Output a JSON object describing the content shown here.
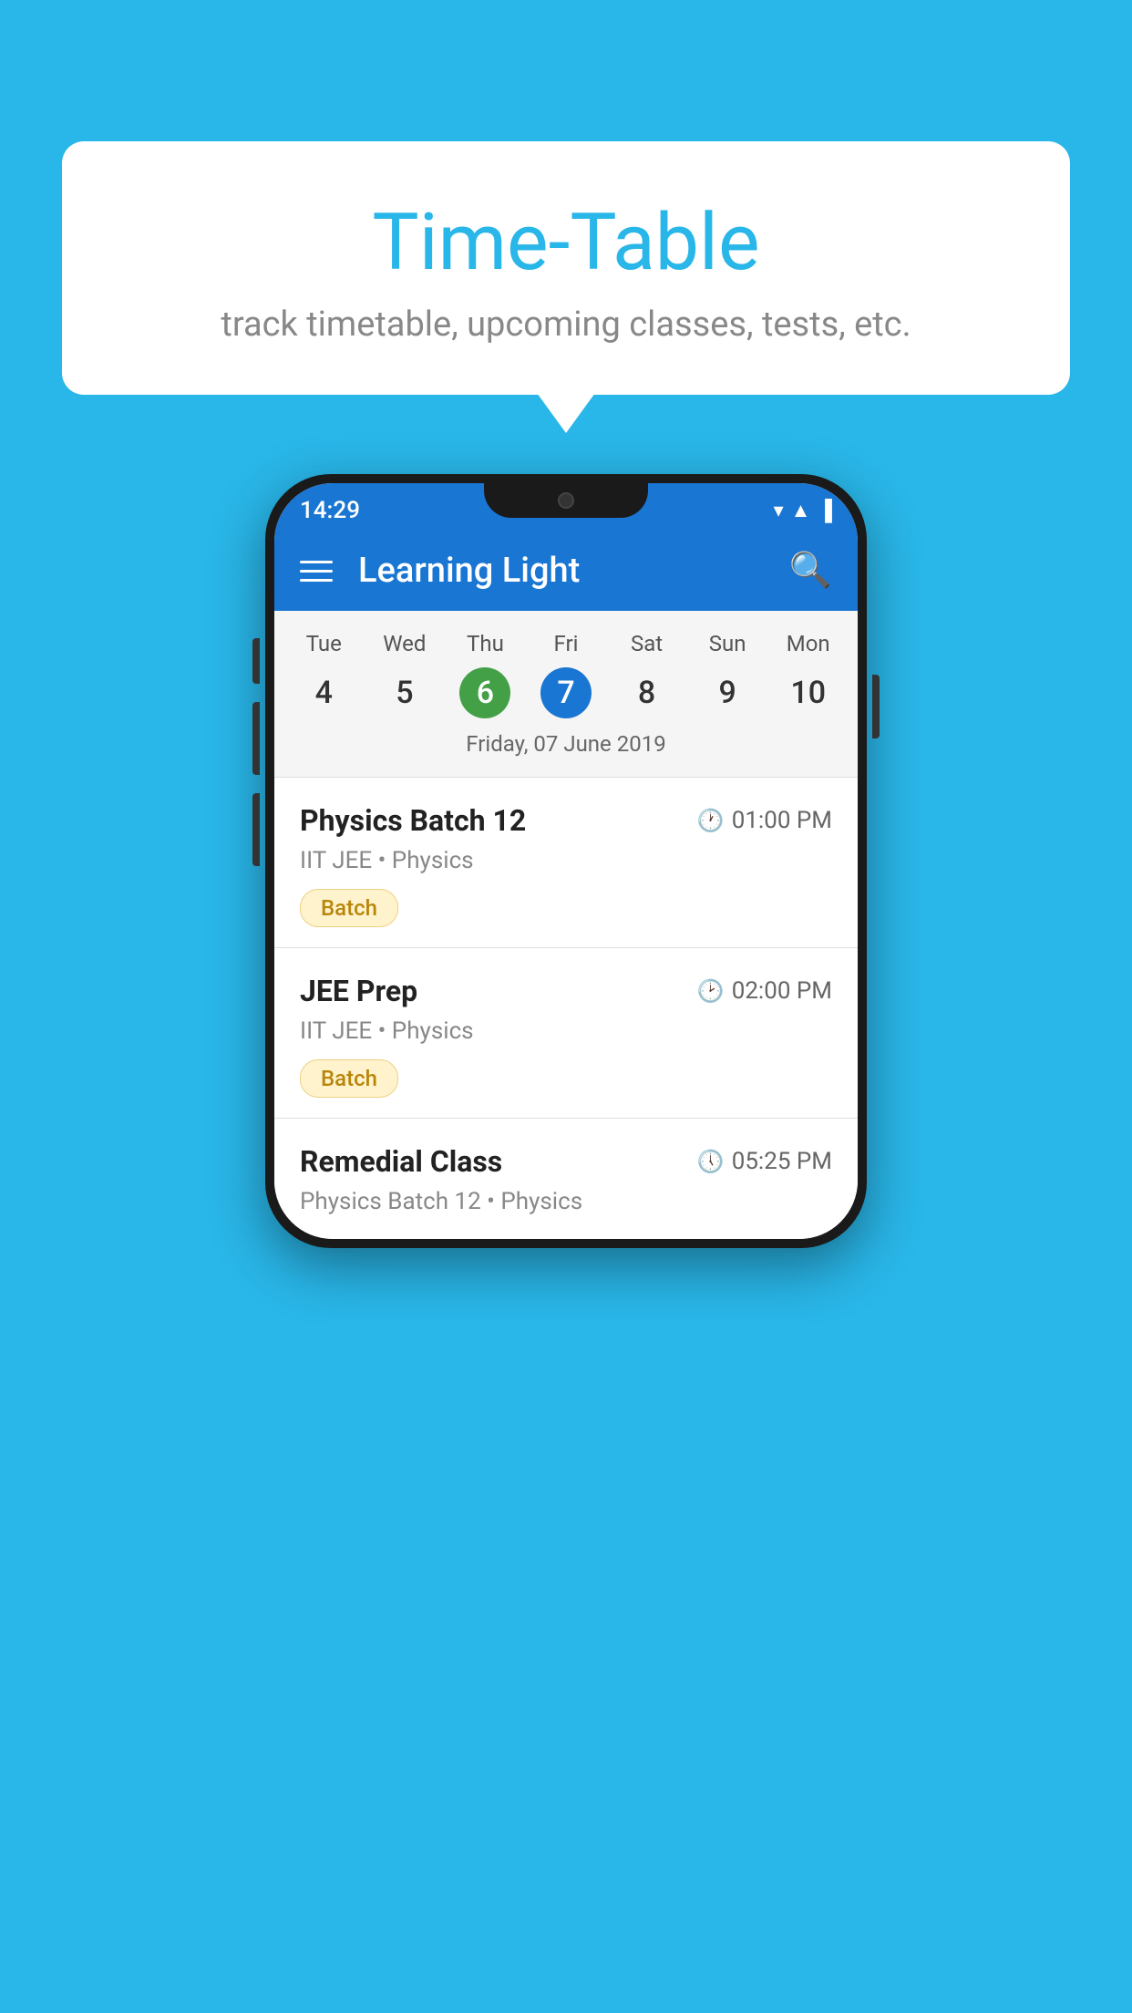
{
  "background_color": "#29B6E8",
  "bubble": {
    "title": "Time-Table",
    "subtitle": "track timetable, upcoming classes, tests, etc."
  },
  "phone": {
    "status_bar": {
      "time": "14:29"
    },
    "header": {
      "title": "Learning Light",
      "hamburger_label": "menu",
      "search_label": "search"
    },
    "calendar": {
      "days": [
        {
          "label": "Tue",
          "num": "4"
        },
        {
          "label": "Wed",
          "num": "5"
        },
        {
          "label": "Thu",
          "num": "6",
          "state": "today"
        },
        {
          "label": "Fri",
          "num": "7",
          "state": "selected"
        },
        {
          "label": "Sat",
          "num": "8"
        },
        {
          "label": "Sun",
          "num": "9"
        },
        {
          "label": "Mon",
          "num": "10"
        }
      ],
      "selected_date": "Friday, 07 June 2019"
    },
    "schedule": [
      {
        "title": "Physics Batch 12",
        "time": "01:00 PM",
        "sub": "IIT JEE • Physics",
        "badge": "Batch"
      },
      {
        "title": "JEE Prep",
        "time": "02:00 PM",
        "sub": "IIT JEE • Physics",
        "badge": "Batch"
      },
      {
        "title": "Remedial Class",
        "time": "05:25 PM",
        "sub": "Physics Batch 12 • Physics"
      }
    ]
  }
}
